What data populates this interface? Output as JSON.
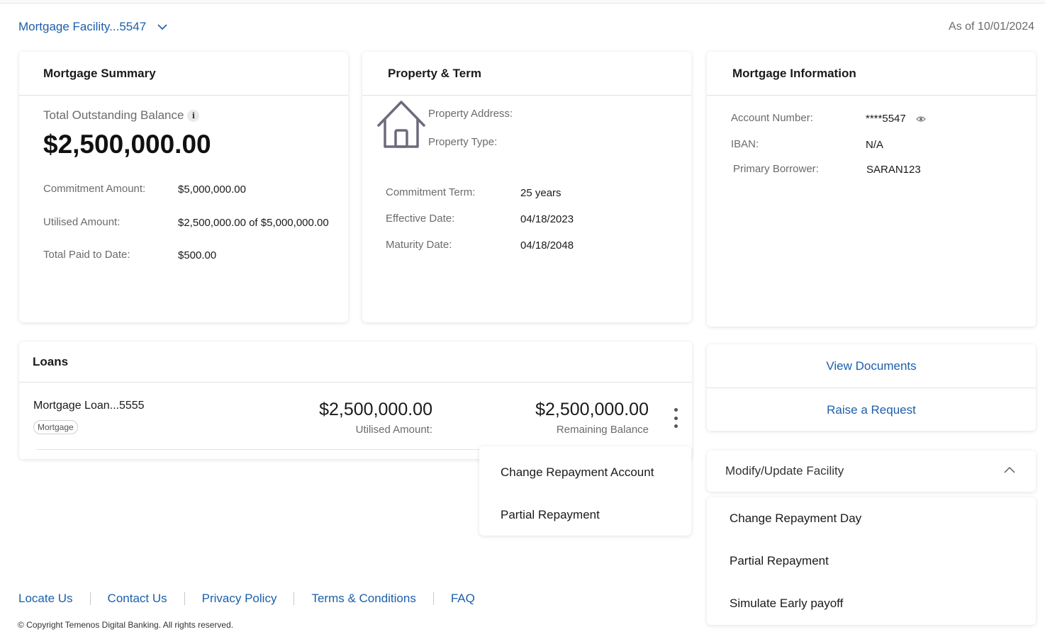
{
  "header": {
    "facility_label": "Mortgage Facility...5547",
    "as_of": "As of 10/01/2024"
  },
  "summary": {
    "title": "Mortgage Summary",
    "balance_label": "Total Outstanding Balance",
    "info_glyph": "i",
    "balance": "$2,500,000.00",
    "rows": [
      {
        "label": "Commitment Amount:",
        "value": "$5,000,000.00"
      },
      {
        "label": "Utilised Amount:",
        "value": "$2,500,000.00 of $5,000,000.00"
      },
      {
        "label": "Total Paid to Date:",
        "value": "$500.00"
      }
    ]
  },
  "property": {
    "title": "Property & Term",
    "address_label": "Property Address:",
    "type_label": "Property Type:",
    "rows": [
      {
        "label": "Commitment Term:",
        "value": "25 years"
      },
      {
        "label": "Effective Date:",
        "value": "04/18/2023"
      },
      {
        "label": "Maturity Date:",
        "value": "04/18/2048"
      }
    ]
  },
  "info": {
    "title": "Mortgage Information",
    "rows": [
      {
        "label": "Account Number:",
        "value": "****5547"
      },
      {
        "label": "IBAN:",
        "value": "N/A"
      },
      {
        "label": "Primary Borrower:",
        "value": "SARAN123"
      }
    ]
  },
  "loans": {
    "title": "Loans",
    "items": [
      {
        "name": "Mortgage Loan...5555",
        "tag": "Mortgage",
        "utilised_amount": "$2,500,000.00",
        "utilised_label": "Utilised Amount:",
        "remaining_balance": "$2,500,000.00",
        "remaining_label": "Remaining Balance"
      }
    ]
  },
  "loan_menu": {
    "items": [
      "Change Repayment Account",
      "Partial Repayment"
    ]
  },
  "actions": {
    "view_documents": "View Documents",
    "raise_request": "Raise a Request"
  },
  "modify": {
    "title": "Modify/Update Facility",
    "items": [
      "Change Repayment Day",
      "Partial Repayment",
      "Simulate Early payoff"
    ]
  },
  "footer": {
    "links": [
      "Locate Us",
      "Contact Us",
      "Privacy Policy",
      "Terms & Conditions",
      "FAQ"
    ],
    "copyright": "© Copyright Temenos Digital Banking. All rights reserved."
  },
  "colors": {
    "link_blue": "#1b5fab",
    "muted_text": "#6b6b6b"
  }
}
